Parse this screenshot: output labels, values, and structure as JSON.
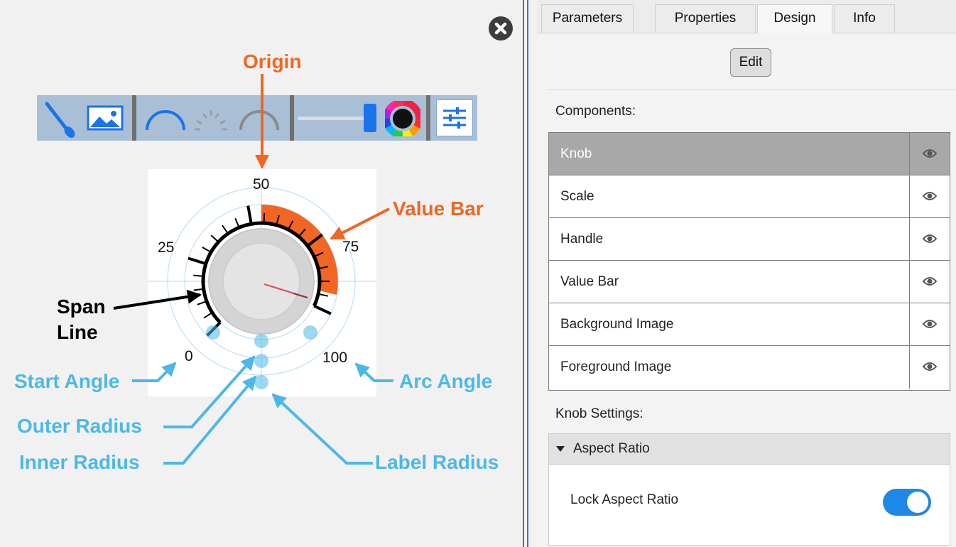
{
  "knob_preview": {
    "scale_labels": [
      "0",
      "25",
      "50",
      "75",
      "100"
    ],
    "value_bar_color": "#f26522",
    "span_line_color": "#000000",
    "needle_color": "#e05252"
  },
  "toolbar": {
    "icons": [
      "handle-icon",
      "image-icon",
      "scale-arc-icon",
      "scale-ticks-icon",
      "value-bar-arc-icon",
      "slider-icon",
      "color-wheel-icon",
      "settings-sliders-icon"
    ]
  },
  "callouts": {
    "origin": "Origin",
    "value_bar": "Value Bar",
    "span_line_1": "Span",
    "span_line_2": "Line",
    "start_angle": "Start Angle",
    "arc_angle": "Arc Angle",
    "outer_radius": "Outer Radius",
    "inner_radius": "Inner Radius",
    "label_radius": "Label Radius",
    "orange_color": "#f26522",
    "blue_color": "#4db8e8",
    "black_color": "#000000"
  },
  "tabs": [
    {
      "label": "Parameters"
    },
    {
      "label": "Properties"
    },
    {
      "label": "Design"
    },
    {
      "label": "Info"
    }
  ],
  "active_tab": "Design",
  "edit_button": "Edit",
  "components_label": "Components:",
  "components": [
    {
      "name": "Knob",
      "selected": true
    },
    {
      "name": "Scale"
    },
    {
      "name": "Handle"
    },
    {
      "name": "Value Bar"
    },
    {
      "name": "Background Image"
    },
    {
      "name": "Foreground Image"
    }
  ],
  "knob_settings_label": "Knob Settings:",
  "aspect_ratio": {
    "title": "Aspect Ratio",
    "lock_label": "Lock Aspect Ratio",
    "lock_on": true
  }
}
